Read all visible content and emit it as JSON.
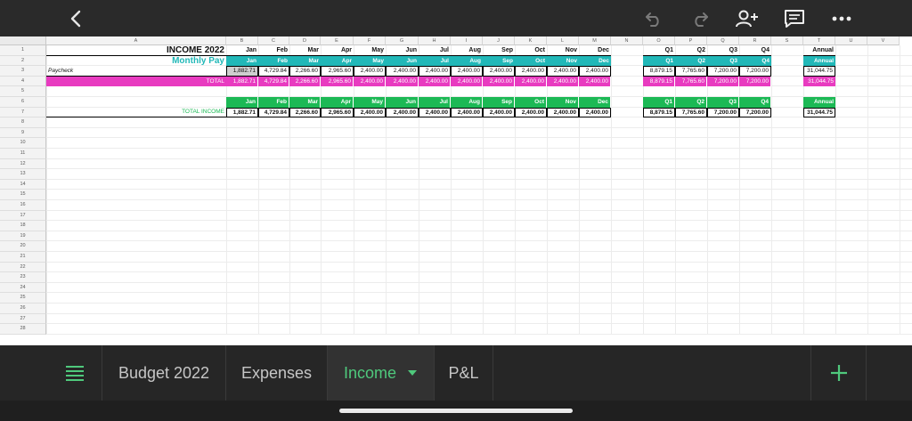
{
  "toolbar": {
    "back": "back-arrow",
    "undo": "undo-arrow",
    "redo": "redo-arrow",
    "share": "add-person",
    "comments": "comment",
    "more": "more-dots"
  },
  "sheet": {
    "columns": [
      "A",
      "B",
      "C",
      "D",
      "E",
      "F",
      "G",
      "H",
      "I",
      "J",
      "K",
      "L",
      "M",
      "N",
      "O",
      "P",
      "Q",
      "R",
      "S",
      "T",
      "U",
      "V"
    ],
    "rows": [
      "1",
      "2",
      "3",
      "4",
      "5",
      "6",
      "7",
      "8",
      "9",
      "10",
      "11",
      "12",
      "13",
      "14",
      "15",
      "16",
      "17",
      "18",
      "19",
      "20",
      "21",
      "22",
      "23",
      "24",
      "25",
      "26",
      "27",
      "28"
    ],
    "title": "INCOME 2022",
    "monthly_pay": "Monthly Pay",
    "months": [
      "Jan",
      "Feb",
      "Mar",
      "Apr",
      "May",
      "Jun",
      "Jul",
      "Aug",
      "Sep",
      "Oct",
      "Nov",
      "Dec"
    ],
    "quarters": [
      "Q1",
      "Q2",
      "Q3",
      "Q4"
    ],
    "annual": "Annual",
    "paycheck_label": "Paycheck",
    "total_label": "TOTAL",
    "total_income_label": "TOTAL INCOME",
    "monthly_values": [
      "1,882.71",
      "4,729.84",
      "2,266.60",
      "2,965.60",
      "2,400.00",
      "2,400.00",
      "2,400.00",
      "2,400.00",
      "2,400.00",
      "2,400.00",
      "2,400.00",
      "2,400.00"
    ],
    "quarter_values": [
      "8,879.15",
      "7,765.60",
      "7,200.00",
      "7,200.00"
    ],
    "annual_value": "31,044.75"
  },
  "colors": {
    "teal": "#21b8b8",
    "pink": "#e83bc0",
    "green": "#1cb955",
    "accent": "#4fc97c"
  },
  "tabs": {
    "menu": "list-icon",
    "items": [
      "Budget 2022",
      "Expenses",
      "Income",
      "P&L"
    ],
    "active": "Income",
    "add": "plus-icon"
  }
}
